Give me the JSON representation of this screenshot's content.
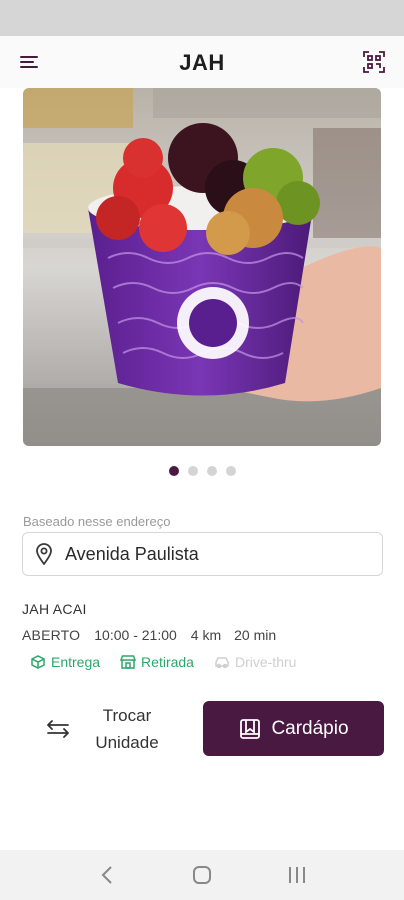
{
  "header": {
    "title": "JAH",
    "menu_icon": "menu-icon",
    "qr_icon": "qr-scan-icon"
  },
  "hero": {
    "image": "acai-bowl-photo",
    "carousel": {
      "count": 4,
      "active_index": 0
    }
  },
  "address": {
    "label": "Baseado nesse endereço",
    "value": "Avenida Paulista",
    "icon": "location-pin-icon"
  },
  "store": {
    "name": "JAH ACAI",
    "status": "ABERTO",
    "hours": "10:00 - 21:00",
    "distance": "4 km",
    "time": "20 min",
    "services": [
      {
        "label": "Entrega",
        "icon": "box-icon",
        "available": true
      },
      {
        "label": "Retirada",
        "icon": "store-icon",
        "available": true
      },
      {
        "label": "Drive-thru",
        "icon": "car-icon",
        "available": false
      }
    ]
  },
  "actions": {
    "switch_label": "Trocar Unidade",
    "menu_label": "Cardápio"
  },
  "colors": {
    "brand": "#4a1942",
    "service_available": "#2aa86a",
    "service_unavailable": "#cfcfcf"
  }
}
